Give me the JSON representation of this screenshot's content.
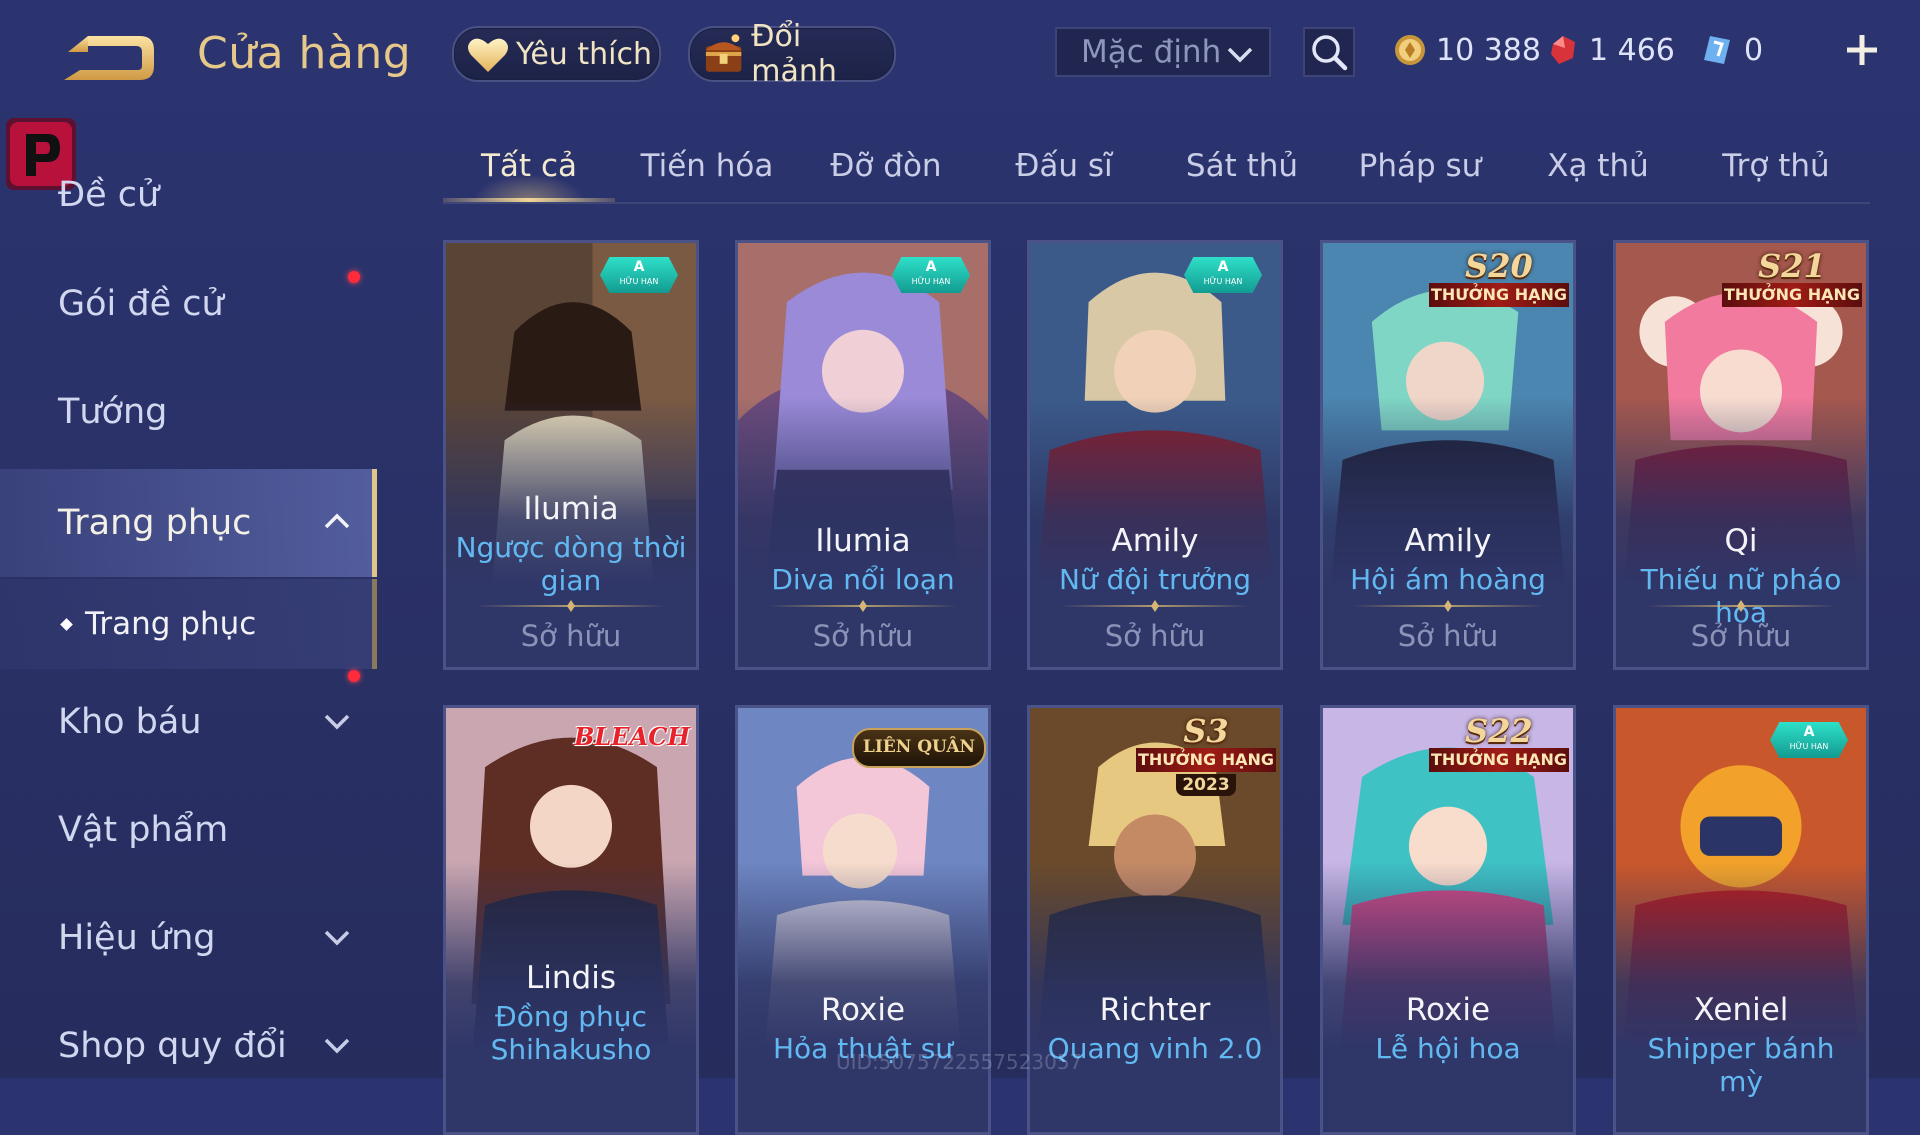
{
  "header": {
    "title": "Cửa hàng",
    "favorites_label": "Yêu thích",
    "shards_label": "Đổi mảnh",
    "sort_label": "Mặc định",
    "gold": "10 388",
    "ruby": "1 466",
    "vouchers": "0"
  },
  "sidebar": {
    "items": [
      {
        "label": "Đề cử"
      },
      {
        "label": "Gói đề cử"
      },
      {
        "label": "Tướng"
      },
      {
        "label": "Trang phục"
      },
      {
        "label": "Trang phục"
      },
      {
        "label": "Kho báu"
      },
      {
        "label": "Vật phẩm"
      },
      {
        "label": "Hiệu ứng"
      },
      {
        "label": "Shop quy đổi"
      }
    ]
  },
  "tabs": [
    "Tất cả",
    "Tiến hóa",
    "Đỡ đòn",
    "Đấu sĩ",
    "Sát thủ",
    "Pháp sư",
    "Xạ thủ",
    "Trợ thủ"
  ],
  "badges": {
    "limited_grade": "A",
    "limited_text": "HỮU HẠN",
    "rank_text": "THƯỞNG HẠNG",
    "bleach": "BLEACH",
    "lien_quan": "LIÊN QUÂN"
  },
  "cards": [
    {
      "hero": "Ilumia",
      "skin_line1": "Ngược dòng thời",
      "skin_line2": "gian",
      "status": "Sở hữu",
      "tag": "limited"
    },
    {
      "hero": "Ilumia",
      "skin_line1": "Diva nổi loạn",
      "skin_line2": "",
      "status": "Sở hữu",
      "tag": "limited"
    },
    {
      "hero": "Amily",
      "skin_line1": "Nữ đội trưởng",
      "skin_line2": "",
      "status": "Sở hữu",
      "tag": "limited"
    },
    {
      "hero": "Amily",
      "skin_line1": "Hội ám hoàng",
      "skin_line2": "",
      "status": "Sở hữu",
      "tag": "S20"
    },
    {
      "hero": "Qi",
      "skin_line1": "Thiếu nữ pháo hoa",
      "skin_line2": "",
      "status": "Sở hữu",
      "tag": "S21"
    },
    {
      "hero": "Lindis",
      "skin_line1": "Đồng phục",
      "skin_line2": "Shihakusho",
      "tag": "bleach"
    },
    {
      "hero": "Roxie",
      "skin_line1": "Hỏa thuật sư",
      "skin_line2": "",
      "tag": "lienquan"
    },
    {
      "hero": "Richter",
      "skin_line1": "Quang vinh 2.0",
      "skin_line2": "",
      "tag": "S3",
      "year": "2023"
    },
    {
      "hero": "Roxie",
      "skin_line1": "Lễ hội hoa",
      "skin_line2": "",
      "tag": "S22"
    },
    {
      "hero": "Xeniel",
      "skin_line1": "Shipper bánh mỳ",
      "skin_line2": "",
      "tag": "limited"
    }
  ],
  "uid": "UID:5075722557523057",
  "colors": {
    "background": "#2b3470",
    "gold_accent": "#e6c98a",
    "skin_name_blue": "#62b9f2",
    "notification_red": "#ff2a3a"
  }
}
